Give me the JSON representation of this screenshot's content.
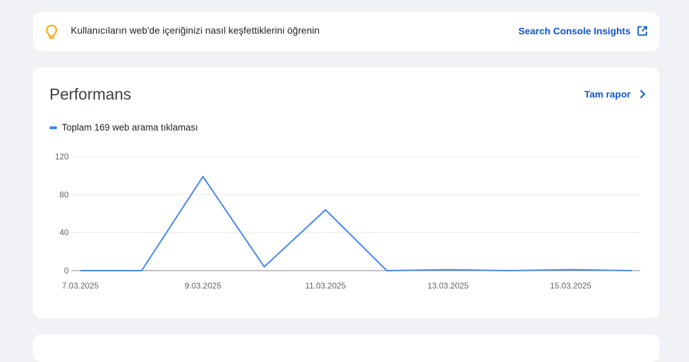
{
  "insight": {
    "icon": "lightbulb-icon",
    "message": "Kullanıcıların web'de içeriğinizi nasıl keşfettiklerini öğrenin",
    "link_label": "Search Console Insights",
    "link_icon": "open-in-new-icon"
  },
  "performance": {
    "title": "Performans",
    "full_report_label": "Tam rapor",
    "full_report_icon": "chevron-right-icon",
    "legend_label": "Toplam 169 web arama tıklaması"
  },
  "colors": {
    "accent": "#0b57d0",
    "series": "#4285f4",
    "bulb": "#f9ab00"
  },
  "chart_data": {
    "type": "line",
    "x": [
      "7.03.2025",
      "8.03.2025",
      "9.03.2025",
      "10.03.2025",
      "11.03.2025",
      "12.03.2025",
      "13.03.2025",
      "14.03.2025",
      "15.03.2025",
      "16.03.2025"
    ],
    "x_tick_labels": [
      "7.03.2025",
      "9.03.2025",
      "11.03.2025",
      "13.03.2025",
      "15.03.2025"
    ],
    "series": [
      {
        "values": [
          0,
          0,
          99,
          4,
          64,
          0,
          1,
          0,
          1,
          0
        ]
      }
    ],
    "y_ticks": [
      0,
      40,
      80,
      120
    ],
    "ylim": [
      0,
      120
    ],
    "grid": true,
    "legend": "top-left"
  }
}
